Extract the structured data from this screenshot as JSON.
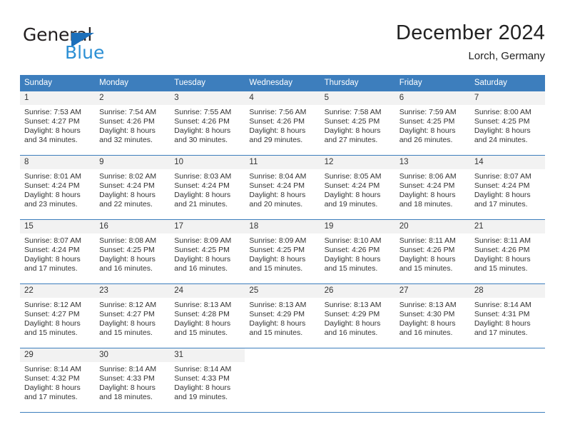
{
  "brand": {
    "name_part1": "General",
    "name_part2": "Blue",
    "triangle_color": "#1c6fba",
    "blue_color": "#2b8fd4"
  },
  "header": {
    "month_title": "December 2024",
    "location": "Lorch, Germany"
  },
  "theme": {
    "header_bg": "#3d7ebd",
    "daynum_bg": "#f2f2f2",
    "grid_line": "#3d7ebd",
    "text": "#333333"
  },
  "weekday_headers": [
    "Sunday",
    "Monday",
    "Tuesday",
    "Wednesday",
    "Thursday",
    "Friday",
    "Saturday"
  ],
  "weeks": [
    [
      {
        "day": "1",
        "sunrise": "Sunrise: 7:53 AM",
        "sunset": "Sunset: 4:27 PM",
        "daylight1": "Daylight: 8 hours",
        "daylight2": "and 34 minutes."
      },
      {
        "day": "2",
        "sunrise": "Sunrise: 7:54 AM",
        "sunset": "Sunset: 4:26 PM",
        "daylight1": "Daylight: 8 hours",
        "daylight2": "and 32 minutes."
      },
      {
        "day": "3",
        "sunrise": "Sunrise: 7:55 AM",
        "sunset": "Sunset: 4:26 PM",
        "daylight1": "Daylight: 8 hours",
        "daylight2": "and 30 minutes."
      },
      {
        "day": "4",
        "sunrise": "Sunrise: 7:56 AM",
        "sunset": "Sunset: 4:26 PM",
        "daylight1": "Daylight: 8 hours",
        "daylight2": "and 29 minutes."
      },
      {
        "day": "5",
        "sunrise": "Sunrise: 7:58 AM",
        "sunset": "Sunset: 4:25 PM",
        "daylight1": "Daylight: 8 hours",
        "daylight2": "and 27 minutes."
      },
      {
        "day": "6",
        "sunrise": "Sunrise: 7:59 AM",
        "sunset": "Sunset: 4:25 PM",
        "daylight1": "Daylight: 8 hours",
        "daylight2": "and 26 minutes."
      },
      {
        "day": "7",
        "sunrise": "Sunrise: 8:00 AM",
        "sunset": "Sunset: 4:25 PM",
        "daylight1": "Daylight: 8 hours",
        "daylight2": "and 24 minutes."
      }
    ],
    [
      {
        "day": "8",
        "sunrise": "Sunrise: 8:01 AM",
        "sunset": "Sunset: 4:24 PM",
        "daylight1": "Daylight: 8 hours",
        "daylight2": "and 23 minutes."
      },
      {
        "day": "9",
        "sunrise": "Sunrise: 8:02 AM",
        "sunset": "Sunset: 4:24 PM",
        "daylight1": "Daylight: 8 hours",
        "daylight2": "and 22 minutes."
      },
      {
        "day": "10",
        "sunrise": "Sunrise: 8:03 AM",
        "sunset": "Sunset: 4:24 PM",
        "daylight1": "Daylight: 8 hours",
        "daylight2": "and 21 minutes."
      },
      {
        "day": "11",
        "sunrise": "Sunrise: 8:04 AM",
        "sunset": "Sunset: 4:24 PM",
        "daylight1": "Daylight: 8 hours",
        "daylight2": "and 20 minutes."
      },
      {
        "day": "12",
        "sunrise": "Sunrise: 8:05 AM",
        "sunset": "Sunset: 4:24 PM",
        "daylight1": "Daylight: 8 hours",
        "daylight2": "and 19 minutes."
      },
      {
        "day": "13",
        "sunrise": "Sunrise: 8:06 AM",
        "sunset": "Sunset: 4:24 PM",
        "daylight1": "Daylight: 8 hours",
        "daylight2": "and 18 minutes."
      },
      {
        "day": "14",
        "sunrise": "Sunrise: 8:07 AM",
        "sunset": "Sunset: 4:24 PM",
        "daylight1": "Daylight: 8 hours",
        "daylight2": "and 17 minutes."
      }
    ],
    [
      {
        "day": "15",
        "sunrise": "Sunrise: 8:07 AM",
        "sunset": "Sunset: 4:24 PM",
        "daylight1": "Daylight: 8 hours",
        "daylight2": "and 17 minutes."
      },
      {
        "day": "16",
        "sunrise": "Sunrise: 8:08 AM",
        "sunset": "Sunset: 4:25 PM",
        "daylight1": "Daylight: 8 hours",
        "daylight2": "and 16 minutes."
      },
      {
        "day": "17",
        "sunrise": "Sunrise: 8:09 AM",
        "sunset": "Sunset: 4:25 PM",
        "daylight1": "Daylight: 8 hours",
        "daylight2": "and 16 minutes."
      },
      {
        "day": "18",
        "sunrise": "Sunrise: 8:09 AM",
        "sunset": "Sunset: 4:25 PM",
        "daylight1": "Daylight: 8 hours",
        "daylight2": "and 15 minutes."
      },
      {
        "day": "19",
        "sunrise": "Sunrise: 8:10 AM",
        "sunset": "Sunset: 4:26 PM",
        "daylight1": "Daylight: 8 hours",
        "daylight2": "and 15 minutes."
      },
      {
        "day": "20",
        "sunrise": "Sunrise: 8:11 AM",
        "sunset": "Sunset: 4:26 PM",
        "daylight1": "Daylight: 8 hours",
        "daylight2": "and 15 minutes."
      },
      {
        "day": "21",
        "sunrise": "Sunrise: 8:11 AM",
        "sunset": "Sunset: 4:26 PM",
        "daylight1": "Daylight: 8 hours",
        "daylight2": "and 15 minutes."
      }
    ],
    [
      {
        "day": "22",
        "sunrise": "Sunrise: 8:12 AM",
        "sunset": "Sunset: 4:27 PM",
        "daylight1": "Daylight: 8 hours",
        "daylight2": "and 15 minutes."
      },
      {
        "day": "23",
        "sunrise": "Sunrise: 8:12 AM",
        "sunset": "Sunset: 4:27 PM",
        "daylight1": "Daylight: 8 hours",
        "daylight2": "and 15 minutes."
      },
      {
        "day": "24",
        "sunrise": "Sunrise: 8:13 AM",
        "sunset": "Sunset: 4:28 PM",
        "daylight1": "Daylight: 8 hours",
        "daylight2": "and 15 minutes."
      },
      {
        "day": "25",
        "sunrise": "Sunrise: 8:13 AM",
        "sunset": "Sunset: 4:29 PM",
        "daylight1": "Daylight: 8 hours",
        "daylight2": "and 15 minutes."
      },
      {
        "day": "26",
        "sunrise": "Sunrise: 8:13 AM",
        "sunset": "Sunset: 4:29 PM",
        "daylight1": "Daylight: 8 hours",
        "daylight2": "and 16 minutes."
      },
      {
        "day": "27",
        "sunrise": "Sunrise: 8:13 AM",
        "sunset": "Sunset: 4:30 PM",
        "daylight1": "Daylight: 8 hours",
        "daylight2": "and 16 minutes."
      },
      {
        "day": "28",
        "sunrise": "Sunrise: 8:14 AM",
        "sunset": "Sunset: 4:31 PM",
        "daylight1": "Daylight: 8 hours",
        "daylight2": "and 17 minutes."
      }
    ],
    [
      {
        "day": "29",
        "sunrise": "Sunrise: 8:14 AM",
        "sunset": "Sunset: 4:32 PM",
        "daylight1": "Daylight: 8 hours",
        "daylight2": "and 17 minutes."
      },
      {
        "day": "30",
        "sunrise": "Sunrise: 8:14 AM",
        "sunset": "Sunset: 4:33 PM",
        "daylight1": "Daylight: 8 hours",
        "daylight2": "and 18 minutes."
      },
      {
        "day": "31",
        "sunrise": "Sunrise: 8:14 AM",
        "sunset": "Sunset: 4:33 PM",
        "daylight1": "Daylight: 8 hours",
        "daylight2": "and 19 minutes."
      },
      {
        "day": "",
        "sunrise": "",
        "sunset": "",
        "daylight1": "",
        "daylight2": ""
      },
      {
        "day": "",
        "sunrise": "",
        "sunset": "",
        "daylight1": "",
        "daylight2": ""
      },
      {
        "day": "",
        "sunrise": "",
        "sunset": "",
        "daylight1": "",
        "daylight2": ""
      },
      {
        "day": "",
        "sunrise": "",
        "sunset": "",
        "daylight1": "",
        "daylight2": ""
      }
    ]
  ]
}
